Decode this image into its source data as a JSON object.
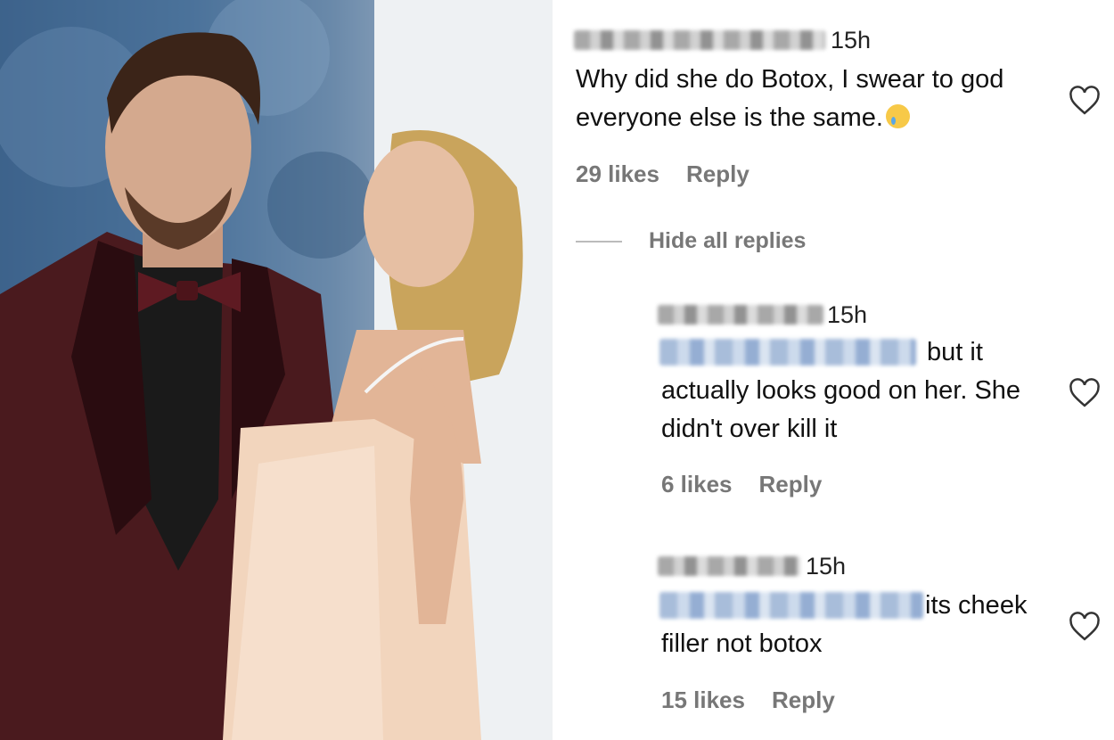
{
  "comments": [
    {
      "time": "15h",
      "text": "Why did she do Botox, I swear to god everyone else is the same.",
      "emoji": "crying-face",
      "likes": "29 likes",
      "reply_label": "Reply"
    }
  ],
  "hide_replies_label": "Hide all replies",
  "replies": [
    {
      "time": "15h",
      "text_suffix": "but it",
      "text_rest": "actually looks good on her. She didn't over kill it",
      "likes": "6 likes",
      "reply_label": "Reply"
    },
    {
      "time": "15h",
      "text_suffix": "its cheek",
      "text_rest": "filler not botox",
      "likes": "15 likes",
      "reply_label": "Reply"
    }
  ],
  "colors": {
    "meta_gray": "#777777",
    "text": "#111111",
    "suit": "#4a1a1e",
    "dress": "#f2d5bd"
  },
  "icons": [
    "heart-outline-icon",
    "crying-face-emoji"
  ]
}
